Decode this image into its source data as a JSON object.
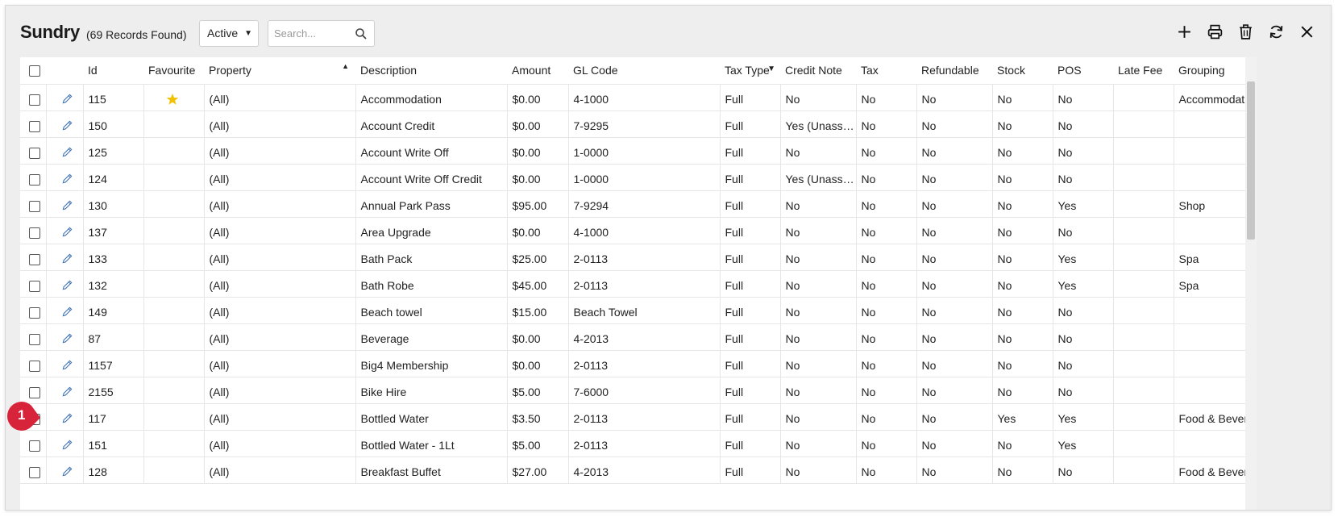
{
  "header": {
    "title": "Sundry",
    "record_count": "(69 Records Found)",
    "status_filter": "Active",
    "search_placeholder": "Search..."
  },
  "toolbar": {
    "buttons": [
      "add-icon",
      "print-icon",
      "delete-icon",
      "refresh-icon",
      "close-icon"
    ]
  },
  "table": {
    "columns": [
      "",
      "",
      "Id",
      "Favourite",
      "Property",
      "Description",
      "Amount",
      "GL Code",
      "Tax Type",
      "Credit Note",
      "Tax",
      "Refundable",
      "Stock",
      "POS",
      "Late Fee",
      "Grouping"
    ],
    "rows": [
      {
        "id": "115",
        "fav": true,
        "property": "(All)",
        "description": "Accommodation",
        "amount": "$0.00",
        "gl": "4-1000",
        "taxtype": "Full",
        "credit": "No",
        "tax": "No",
        "refundable": "No",
        "stock": "No",
        "pos": "No",
        "latefee": "",
        "grouping": "Accommodation"
      },
      {
        "id": "150",
        "fav": false,
        "property": "(All)",
        "description": "Account Credit",
        "amount": "$0.00",
        "gl": "7-9295",
        "taxtype": "Full",
        "credit": "Yes (Unassigned)",
        "tax": "No",
        "refundable": "No",
        "stock": "No",
        "pos": "No",
        "latefee": "",
        "grouping": ""
      },
      {
        "id": "125",
        "fav": false,
        "property": "(All)",
        "description": "Account Write Off",
        "amount": "$0.00",
        "gl": "1-0000",
        "taxtype": "Full",
        "credit": "No",
        "tax": "No",
        "refundable": "No",
        "stock": "No",
        "pos": "No",
        "latefee": "",
        "grouping": ""
      },
      {
        "id": "124",
        "fav": false,
        "property": "(All)",
        "description": "Account Write Off Credit",
        "amount": "$0.00",
        "gl": "1-0000",
        "taxtype": "Full",
        "credit": "Yes (Unassigned)",
        "tax": "No",
        "refundable": "No",
        "stock": "No",
        "pos": "No",
        "latefee": "",
        "grouping": ""
      },
      {
        "id": "130",
        "fav": false,
        "property": "(All)",
        "description": "Annual Park Pass",
        "amount": "$95.00",
        "gl": "7-9294",
        "taxtype": "Full",
        "credit": "No",
        "tax": "No",
        "refundable": "No",
        "stock": "No",
        "pos": "Yes",
        "latefee": "",
        "grouping": "Shop"
      },
      {
        "id": "137",
        "fav": false,
        "property": "(All)",
        "description": "Area Upgrade",
        "amount": "$0.00",
        "gl": "4-1000",
        "taxtype": "Full",
        "credit": "No",
        "tax": "No",
        "refundable": "No",
        "stock": "No",
        "pos": "No",
        "latefee": "",
        "grouping": ""
      },
      {
        "id": "133",
        "fav": false,
        "property": "(All)",
        "description": "Bath Pack",
        "amount": "$25.00",
        "gl": "2-0113",
        "taxtype": "Full",
        "credit": "No",
        "tax": "No",
        "refundable": "No",
        "stock": "No",
        "pos": "Yes",
        "latefee": "",
        "grouping": "Spa"
      },
      {
        "id": "132",
        "fav": false,
        "property": "(All)",
        "description": "Bath Robe",
        "amount": "$45.00",
        "gl": "2-0113",
        "taxtype": "Full",
        "credit": "No",
        "tax": "No",
        "refundable": "No",
        "stock": "No",
        "pos": "Yes",
        "latefee": "",
        "grouping": "Spa"
      },
      {
        "id": "149",
        "fav": false,
        "property": "(All)",
        "description": "Beach towel",
        "amount": "$15.00",
        "gl": "Beach Towel",
        "taxtype": "Full",
        "credit": "No",
        "tax": "No",
        "refundable": "No",
        "stock": "No",
        "pos": "No",
        "latefee": "",
        "grouping": ""
      },
      {
        "id": "87",
        "fav": false,
        "property": "(All)",
        "description": "Beverage",
        "amount": "$0.00",
        "gl": "4-2013",
        "taxtype": "Full",
        "credit": "No",
        "tax": "No",
        "refundable": "No",
        "stock": "No",
        "pos": "No",
        "latefee": "",
        "grouping": ""
      },
      {
        "id": "1157",
        "fav": false,
        "property": "(All)",
        "description": "Big4 Membership",
        "amount": "$0.00",
        "gl": "2-0113",
        "taxtype": "Full",
        "credit": "No",
        "tax": "No",
        "refundable": "No",
        "stock": "No",
        "pos": "No",
        "latefee": "",
        "grouping": ""
      },
      {
        "id": "2155",
        "fav": false,
        "property": "(All)",
        "description": "Bike Hire",
        "amount": "$5.00",
        "gl": "7-6000",
        "taxtype": "Full",
        "credit": "No",
        "tax": "No",
        "refundable": "No",
        "stock": "No",
        "pos": "No",
        "latefee": "",
        "grouping": ""
      },
      {
        "id": "117",
        "fav": false,
        "property": "(All)",
        "description": "Bottled Water",
        "amount": "$3.50",
        "gl": "2-0113",
        "taxtype": "Full",
        "credit": "No",
        "tax": "No",
        "refundable": "No",
        "stock": "Yes",
        "pos": "Yes",
        "latefee": "",
        "grouping": "Food & Beverage"
      },
      {
        "id": "151",
        "fav": false,
        "property": "(All)",
        "description": "Bottled Water - 1Lt",
        "amount": "$5.00",
        "gl": "2-0113",
        "taxtype": "Full",
        "credit": "No",
        "tax": "No",
        "refundable": "No",
        "stock": "No",
        "pos": "Yes",
        "latefee": "",
        "grouping": ""
      },
      {
        "id": "128",
        "fav": false,
        "property": "(All)",
        "description": "Breakfast Buffet",
        "amount": "$27.00",
        "gl": "4-2013",
        "taxtype": "Full",
        "credit": "No",
        "tax": "No",
        "refundable": "No",
        "stock": "No",
        "pos": "No",
        "latefee": "",
        "grouping": "Food & Beverage"
      }
    ]
  },
  "callout": {
    "label": "1"
  },
  "colors": {
    "star": "#f2c200",
    "pencil": "#3a6fb0",
    "callout": "#d8243a"
  }
}
